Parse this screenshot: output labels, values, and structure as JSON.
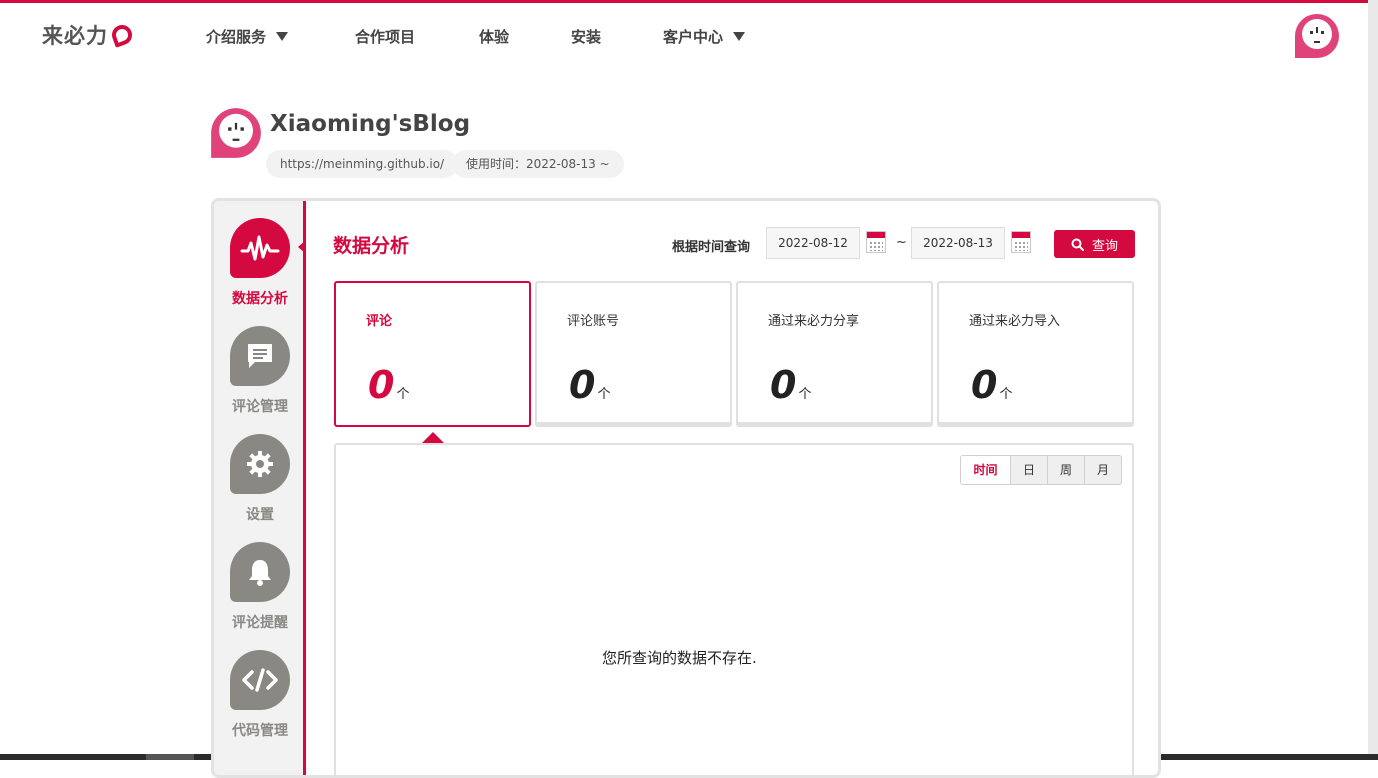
{
  "brand": {
    "name": "来必力"
  },
  "nav": {
    "items": [
      {
        "label": "介绍服务",
        "dropdown": true
      },
      {
        "label": "合作项目",
        "dropdown": false
      },
      {
        "label": "体验",
        "dropdown": false
      },
      {
        "label": "安装",
        "dropdown": false
      },
      {
        "label": "客户中心",
        "dropdown": true
      }
    ]
  },
  "blog": {
    "title": "Xiaoming'sBlog",
    "url": "https://meinming.github.io/",
    "since": "使用时间：2022-08-13 ~"
  },
  "sidebar": {
    "items": [
      {
        "label": "数据分析",
        "icon": "pulse-icon",
        "active": true
      },
      {
        "label": "评论管理",
        "icon": "comment-icon",
        "active": false
      },
      {
        "label": "设置",
        "icon": "gear-icon",
        "active": false
      },
      {
        "label": "评论提醒",
        "icon": "bell-icon",
        "active": false
      },
      {
        "label": "代码管理",
        "icon": "code-icon",
        "active": false
      }
    ]
  },
  "main": {
    "title": "数据分析",
    "query_label": "根据时间查询",
    "date_from": "2022-08-12",
    "date_separator": "~",
    "date_to": "2022-08-13",
    "search_label": "查询",
    "stats": [
      {
        "label": "评论",
        "value": "0",
        "unit": "个",
        "active": true
      },
      {
        "label": "评论账号",
        "value": "0",
        "unit": "个",
        "active": false
      },
      {
        "label": "通过来必力分享",
        "value": "0",
        "unit": "个",
        "active": false
      },
      {
        "label": "通过来必力导入",
        "value": "0",
        "unit": "个",
        "active": false
      }
    ],
    "tabs": [
      {
        "label": "时间",
        "active": true
      },
      {
        "label": "日",
        "active": false
      },
      {
        "label": "周",
        "active": false
      },
      {
        "label": "月",
        "active": false
      }
    ],
    "empty_message": "您所查询的数据不存在."
  },
  "colors": {
    "accent": "#d4093f",
    "icon_gray": "#8a8883",
    "avatar_pink": "#e0427a"
  }
}
